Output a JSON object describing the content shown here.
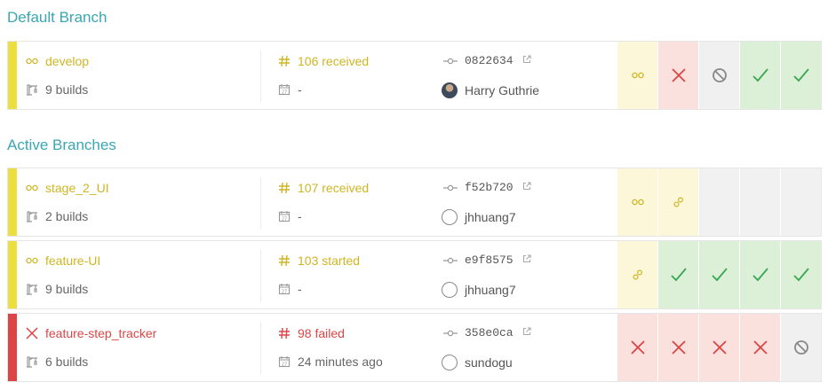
{
  "sections": {
    "default_title": "Default Branch",
    "active_title": "Active Branches"
  },
  "colors": {
    "accent": "#3aa7b0",
    "pending": "#cfb524",
    "failed": "#db4545",
    "passed": "#39a852",
    "canceled": "#888888"
  },
  "default_branch": {
    "status": "pending",
    "name": "develop",
    "builds": "9 builds",
    "request": "106 received",
    "date": "-",
    "commit": "0822634",
    "author": "Harry Guthrie",
    "history": [
      "started",
      "failed",
      "canceled",
      "passed",
      "passed"
    ]
  },
  "active_branches": [
    {
      "status": "pending",
      "name": "stage_2_UI",
      "builds": "2 builds",
      "request": "107 received",
      "date": "-",
      "commit": "f52b720",
      "author": "jhhuang7",
      "history": [
        "started",
        "created",
        "empty",
        "empty",
        "empty"
      ]
    },
    {
      "status": "pending",
      "name": "feature-UI",
      "builds": "9 builds",
      "request": "103 started",
      "date": "-",
      "commit": "e9f8575",
      "author": "jhhuang7",
      "history": [
        "created",
        "passed",
        "passed",
        "passed",
        "passed"
      ]
    },
    {
      "status": "failed",
      "name": "feature-step_tracker",
      "builds": "6 builds",
      "request": "98 failed",
      "date": "24 minutes ago",
      "commit": "358e0ca",
      "author": "sundogu",
      "history": [
        "failed",
        "failed",
        "failed",
        "failed",
        "canceled"
      ]
    }
  ]
}
